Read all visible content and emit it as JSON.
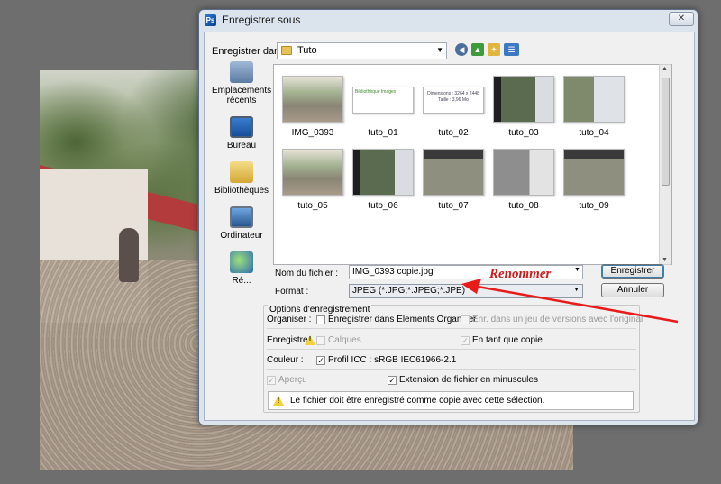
{
  "window": {
    "title": "Enregistrer sous",
    "close_glyph": "✕"
  },
  "lookin": {
    "label": "Enregistrer dans :",
    "value": "Tuto"
  },
  "places": [
    {
      "label": "Emplacements récents",
      "icon": "recent-places-icon"
    },
    {
      "label": "Bureau",
      "icon": "desktop-icon"
    },
    {
      "label": "Bibliothèques",
      "icon": "libraries-icon"
    },
    {
      "label": "Ordinateur",
      "icon": "computer-icon"
    },
    {
      "label": "Ré...",
      "icon": "network-icon"
    }
  ],
  "files": [
    {
      "name": "IMG_0393",
      "kind": "photo"
    },
    {
      "name": "tuto_01",
      "kind": "white"
    },
    {
      "name": "tuto_02",
      "kind": "white"
    },
    {
      "name": "tuto_03",
      "kind": "screen"
    },
    {
      "name": "tuto_04",
      "kind": "photo"
    },
    {
      "name": "tuto_05",
      "kind": "photo"
    },
    {
      "name": "tuto_06",
      "kind": "screen"
    },
    {
      "name": "tuto_07",
      "kind": "dark"
    },
    {
      "name": "tuto_08",
      "kind": "gray"
    },
    {
      "name": "tuto_09",
      "kind": "dark"
    }
  ],
  "thumb_text": {
    "tuto_01": "Bibliothèque Images",
    "tuto_02_a": "Dimensions : 3264 x 2448",
    "tuto_02_b": "Taille : 3,96 Mo"
  },
  "filename": {
    "label": "Nom du fichier :",
    "value": "IMG_0393 copie.jpg"
  },
  "format": {
    "label": "Format :",
    "value": "JPEG (*.JPG;*.JPEG;*.JPE)"
  },
  "buttons": {
    "save": "Enregistrer",
    "cancel": "Annuler"
  },
  "annotation": {
    "text": "Renommer",
    "color": "#d11b1b"
  },
  "options": {
    "title": "Options d'enregistrement",
    "organiser_label": "Organiser :",
    "organiser_check": "Enregistrer dans Elements Organizer",
    "version_check": "Enr. dans un jeu de versions avec l'original",
    "enregistrer_label": "Enregistrer",
    "calques": "Calques",
    "en_tant_que_copie": "En tant que copie",
    "couleur_label": "Couleur :",
    "profil": "Profil ICC : sRGB IEC61966-2.1",
    "apercu": "Aperçu",
    "extension": "Extension de fichier en minuscules",
    "warning": "Le fichier doit être enregistré comme copie avec cette sélection."
  }
}
